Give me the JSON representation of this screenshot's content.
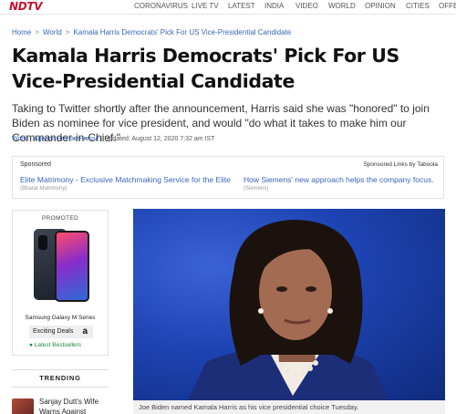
{
  "nav": {
    "logo": "NDTV",
    "items": [
      "CORONAVIRUS",
      "LIVE TV",
      "LATEST",
      "INDIA",
      "VIDEO",
      "WORLD",
      "OPINION",
      "CITIES",
      "OFFBEAT"
    ]
  },
  "breadcrumb": [
    "Home",
    "World",
    "Kamala Harris Democrats' Pick For US Vice-Presidential Candidate"
  ],
  "article": {
    "headline": "Kamala Harris Democrats' Pick For US Vice-Presidential Candidate",
    "summary": "Taking to Twitter shortly after the announcement, Harris said she was \"honored\" to join Biden as nominee for vice president, and would \"do what it takes to make him our Commander-in-Chief.\"",
    "meta": {
      "category": "World",
      "source": "Agence France-Presse",
      "updated": "Updated: August 12, 2020 7:32 am IST"
    },
    "caption": "Joe Biden named Kamala Harris as his vice presidential choice Tuesday."
  },
  "sponsored": {
    "label": "Sponsored",
    "provider": "Sponsored Links by Taboola",
    "items": [
      {
        "title": "Elite Matrimony - Exclusive Matchmaking Service for the Elite",
        "source": "(Bharat Matrimony)"
      },
      {
        "title": "How Siemens' new approach helps the company focus.",
        "source": "(Siemens)"
      }
    ]
  },
  "promo": {
    "label": "PROMOTED",
    "product": "Samsung Galaxy M Series",
    "deals": "Exciting Deals",
    "amazon": "a",
    "bestsellers": "Latest Bestsellers"
  },
  "trending": {
    "label": "TRENDING",
    "items": [
      {
        "title": "Sanjay Dutt's Wife Warns Against"
      }
    ]
  },
  "colors": {
    "brand": "#c8102e",
    "link": "#3a66b8"
  }
}
